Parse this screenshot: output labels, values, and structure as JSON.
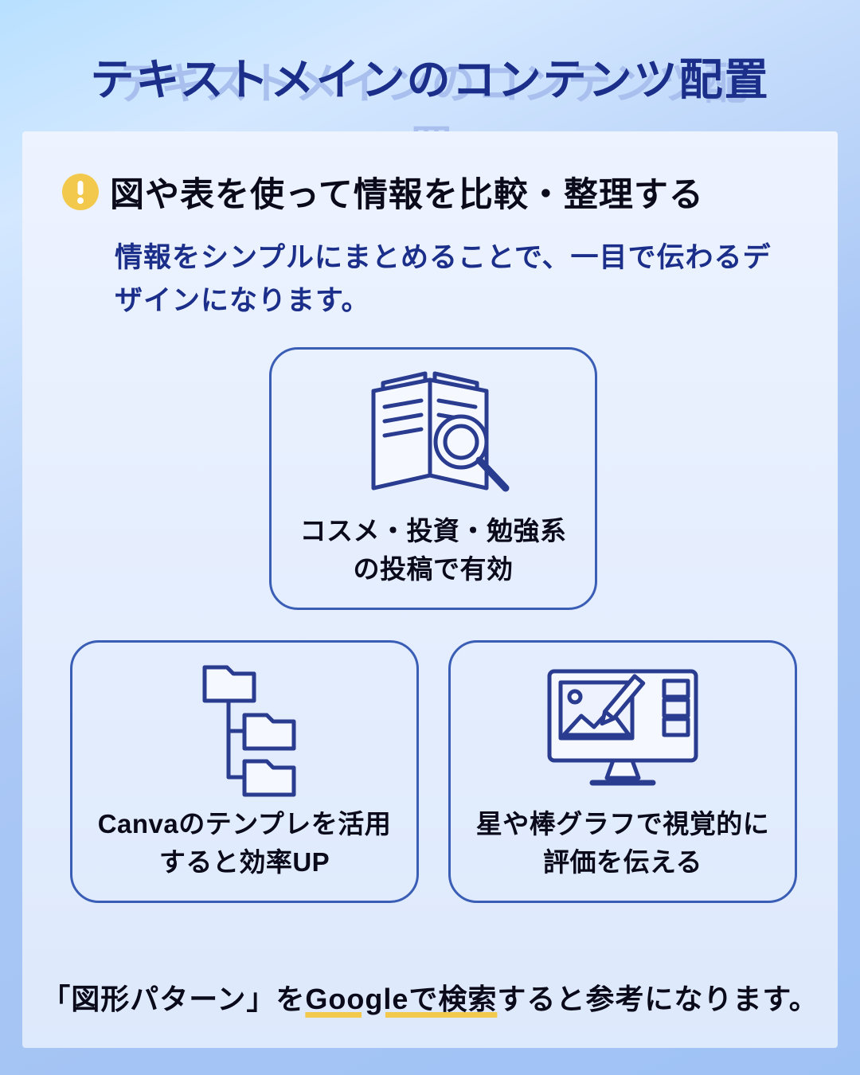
{
  "title": "テキストメインのコンテンツ配置",
  "section": {
    "heading": "図や表を使って情報を比較・整理する",
    "subtext": "情報をシンプルにまとめることで、一目で伝わるデザインになります。"
  },
  "cards": {
    "top": {
      "icon": "book-magnifier-icon",
      "text": "コスメ・投資・勉強系の投稿で有効"
    },
    "bottomLeft": {
      "icon": "folder-tree-icon",
      "text": "Canvaのテンプレを活用すると効率UP"
    },
    "bottomRight": {
      "icon": "monitor-design-icon",
      "text": "星や棒グラフで視覚的に評価を伝える"
    }
  },
  "footer": {
    "prefix": "「図形パターン」を",
    "highlight": "Googleで検索",
    "suffix": "すると参考になります。"
  }
}
